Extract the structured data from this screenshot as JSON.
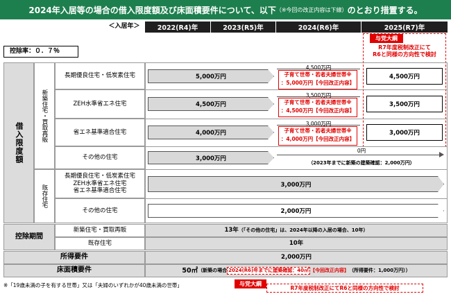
{
  "title": {
    "main": "2024年入居等の場合の借入限度額及び床面積要件について、以下",
    "note": "（※今回の改正内容は下線）",
    "tail": "のとおり措置する。"
  },
  "header": {
    "move_in_label": "＜入居年＞",
    "years": [
      "2022(R4)年",
      "2023(R5)年",
      "2024(R6)年",
      "2025(R7)年"
    ]
  },
  "party_badge": "与党大綱",
  "r7_note": [
    "R7年度税制改正にて",
    "R6と同様の方向性で検討"
  ],
  "deduction_rate": "控除率：０．７％",
  "limit": {
    "section_label": "借入限度額",
    "new_label": "新築住宅・買取再販",
    "existing_label": "既存住宅",
    "rows": [
      {
        "label": "長期優良住宅・低炭素住宅",
        "value_2022_2023": "5,000万円",
        "r6_base": "4,500万円",
        "r6_line1": "子育て世帯・若者夫婦世帯※",
        "r6_line2": "：5,000万円【今回改正内容】",
        "r7": "4,500万円"
      },
      {
        "label": "ZEH水準省エネ住宅",
        "value_2022_2023": "4,500万円",
        "r6_base": "3,500万円",
        "r6_line1": "子育て世帯・若者夫婦世帯※",
        "r6_line2": "：4,500万円【今回改正内容】",
        "r7": "3,500万円"
      },
      {
        "label": "省エネ基準適合住宅",
        "value_2022_2023": "4,000万円",
        "r6_base": "3,000万円",
        "r6_line1": "子育て世帯・若者夫婦世帯※",
        "r6_line2": "：4,000万円【今回改正内容】",
        "r7": "3,000万円"
      }
    ],
    "other_new": {
      "label": "その他の住宅",
      "value": "3,000万円",
      "r6_value": "0円",
      "r6_note": "（2023年までに新築の建築確認：2,000万円）"
    },
    "existing_rows": [
      {
        "label": [
          "長期優良住宅・低炭素住宅",
          "ZEH水準省エネ住宅",
          "省エネ基準適合住宅"
        ],
        "value": "3,000万円"
      },
      {
        "label": [
          "その他の住宅"
        ],
        "value": "2,000万円"
      }
    ]
  },
  "period": {
    "label": "控除期間",
    "new_label": "新築住宅・買取再販",
    "new_value": "13年",
    "new_note": "（「その他の住宅」は、2024年以降の入居の場合、10年）",
    "existing_label": "既存住宅",
    "existing_value": "10年"
  },
  "income": {
    "label": "所得要件",
    "value": "2,000万円"
  },
  "floor": {
    "label": "床面積要件",
    "value": "50㎡",
    "pre": "（新築の場合",
    "boxed": "2024(R6)年までに建築確認：40㎡",
    "revision": "【今回改正内容】",
    "post": "（所得要件：1,000万円））"
  },
  "footnote": "※「19歳未満の子を有する世帯」又は「夫婦のいずれかが40歳未満の世帯」",
  "bottom_badge": "与党大綱",
  "bottom_note": "R7年度税制改正にてR6と同様の方向性で検討"
}
